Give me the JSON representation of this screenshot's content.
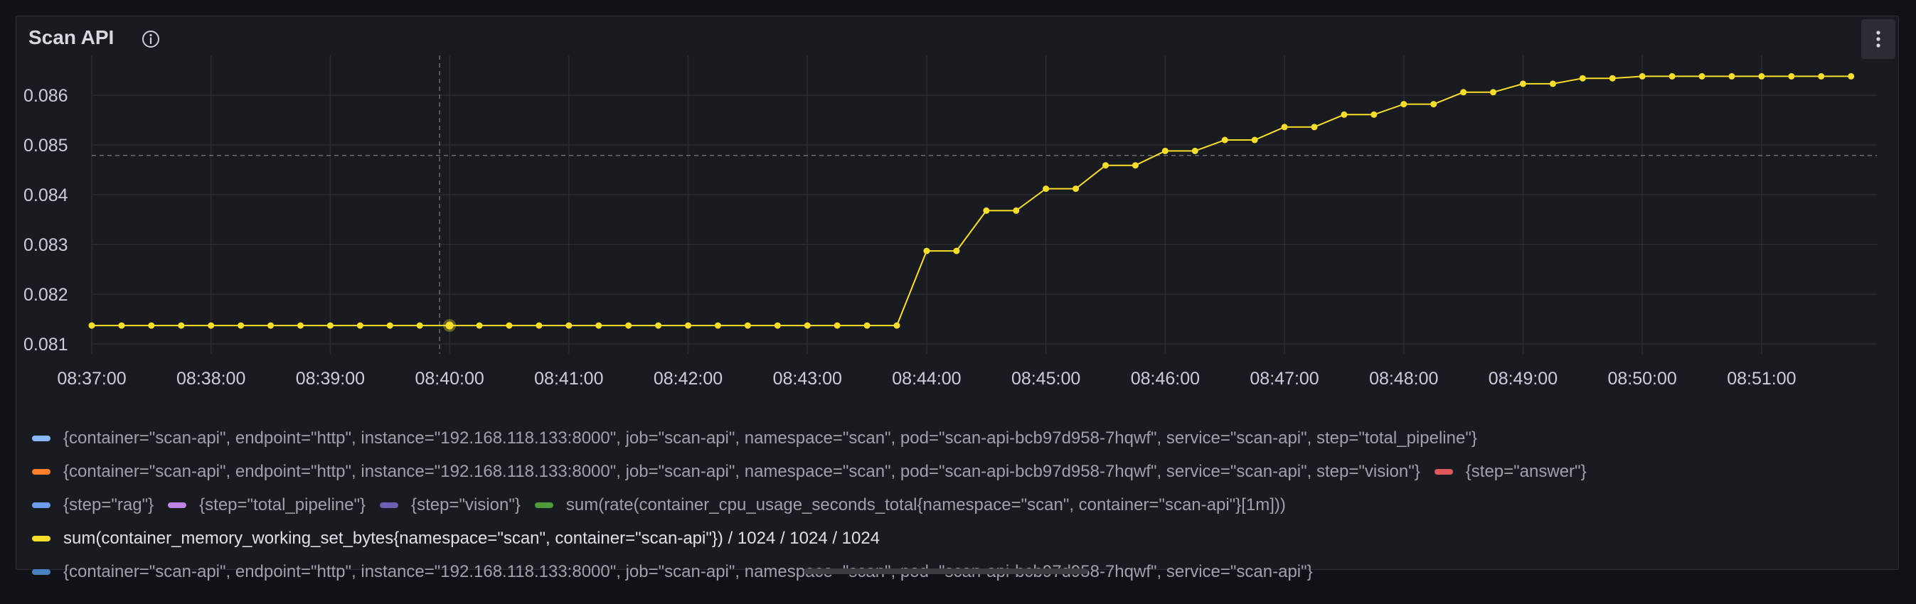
{
  "panel": {
    "title": "Scan API",
    "info_icon": "info-circle-icon",
    "menu_icon": "kebab-menu-icon"
  },
  "colors": {
    "background": "#111217",
    "panel": "#181b1f",
    "grid": "#2a2c31",
    "line": "#fade2a",
    "text": "#ccccdc"
  },
  "chart_data": {
    "type": "line",
    "ylim": [
      0.0808,
      0.0868
    ],
    "yticks": [
      0.081,
      0.082,
      0.083,
      0.084,
      0.085,
      0.086
    ],
    "ytick_labels": [
      "0.081",
      "0.082",
      "0.083",
      "0.084",
      "0.085",
      "0.086"
    ],
    "xlim": [
      "08:37:00",
      "08:51:58"
    ],
    "xticks": [
      "08:37:00",
      "08:38:00",
      "08:39:00",
      "08:40:00",
      "08:41:00",
      "08:42:00",
      "08:43:00",
      "08:44:00",
      "08:45:00",
      "08:46:00",
      "08:47:00",
      "08:48:00",
      "08:49:00",
      "08:50:00",
      "08:51:00"
    ],
    "grid": true,
    "threshold": 0.08479,
    "cursor_time": "08:39:55",
    "highlight_time": "08:40:00",
    "series": [
      {
        "name": "sum(container_memory_working_set_bytes{namespace=\"scan\", container=\"scan-api\"}) / 1024 / 1024 / 1024",
        "color": "#fade2a",
        "x": [
          "08:37:00",
          "08:37:15",
          "08:37:30",
          "08:37:45",
          "08:38:00",
          "08:38:15",
          "08:38:30",
          "08:38:45",
          "08:39:00",
          "08:39:15",
          "08:39:30",
          "08:39:45",
          "08:40:00",
          "08:40:15",
          "08:40:30",
          "08:40:45",
          "08:41:00",
          "08:41:15",
          "08:41:30",
          "08:41:45",
          "08:42:00",
          "08:42:15",
          "08:42:30",
          "08:42:45",
          "08:43:00",
          "08:43:15",
          "08:43:30",
          "08:43:45",
          "08:44:00",
          "08:44:15",
          "08:44:30",
          "08:44:45",
          "08:45:00",
          "08:45:15",
          "08:45:30",
          "08:45:45",
          "08:46:00",
          "08:46:15",
          "08:46:30",
          "08:46:45",
          "08:47:00",
          "08:47:15",
          "08:47:30",
          "08:47:45",
          "08:48:00",
          "08:48:15",
          "08:48:30",
          "08:48:45",
          "08:49:00",
          "08:49:15",
          "08:49:30",
          "08:49:45",
          "08:50:00",
          "08:50:15",
          "08:50:30",
          "08:50:45",
          "08:51:00",
          "08:51:15",
          "08:51:30",
          "08:51:45"
        ],
        "values": [
          0.08137,
          0.08137,
          0.08137,
          0.08137,
          0.08137,
          0.08137,
          0.08137,
          0.08137,
          0.08137,
          0.08137,
          0.08137,
          0.08137,
          0.08137,
          0.08137,
          0.08137,
          0.08137,
          0.08137,
          0.08137,
          0.08137,
          0.08137,
          0.08137,
          0.08137,
          0.08137,
          0.08137,
          0.08137,
          0.08137,
          0.08137,
          0.08137,
          0.08287,
          0.08287,
          0.08368,
          0.08368,
          0.08412,
          0.08412,
          0.08459,
          0.08459,
          0.08488,
          0.08488,
          0.0851,
          0.0851,
          0.08536,
          0.08536,
          0.08561,
          0.08561,
          0.08582,
          0.08582,
          0.08606,
          0.08606,
          0.08623,
          0.08623,
          0.08634,
          0.08634,
          0.08638,
          0.08638,
          0.08638,
          0.08638,
          0.08638,
          0.08638,
          0.08638,
          0.08638
        ]
      }
    ]
  },
  "legend": {
    "rows": [
      [
        {
          "label": "{container=\"scan-api\", endpoint=\"http\", instance=\"192.168.118.133:8000\", job=\"scan-api\", namespace=\"scan\", pod=\"scan-api-bcb97d958-7hqwf\", service=\"scan-api\", step=\"total_pipeline\"}",
          "color": "#8ab8ff",
          "active": false
        }
      ],
      [
        {
          "label": "{container=\"scan-api\", endpoint=\"http\", instance=\"192.168.118.133:8000\", job=\"scan-api\", namespace=\"scan\", pod=\"scan-api-bcb97d958-7hqwf\", service=\"scan-api\", step=\"vision\"}",
          "color": "#ff7f2a",
          "active": false
        },
        {
          "label": "{step=\"answer\"}",
          "color": "#e05a5a",
          "active": false
        }
      ],
      [
        {
          "label": "{step=\"rag\"}",
          "color": "#6e9bef",
          "active": false
        },
        {
          "label": "{step=\"total_pipeline\"}",
          "color": "#c084e8",
          "active": false
        },
        {
          "label": "{step=\"vision\"}",
          "color": "#6a62b0",
          "active": false
        },
        {
          "label": "sum(rate(container_cpu_usage_seconds_total{namespace=\"scan\", container=\"scan-api\"}[1m]))",
          "color": "#4f9a3a",
          "active": false
        }
      ],
      [
        {
          "label": "sum(container_memory_working_set_bytes{namespace=\"scan\", container=\"scan-api\"}) / 1024 / 1024 / 1024",
          "color": "#fade2a",
          "active": true
        }
      ],
      [
        {
          "label": "{container=\"scan-api\", endpoint=\"http\", instance=\"192.168.118.133:8000\", job=\"scan-api\", namespace=\"scan\", pod=\"scan-api-bcb97d958-7hqwf\", service=\"scan-api\"}",
          "color": "#4a7fc0",
          "active": false
        }
      ]
    ]
  }
}
